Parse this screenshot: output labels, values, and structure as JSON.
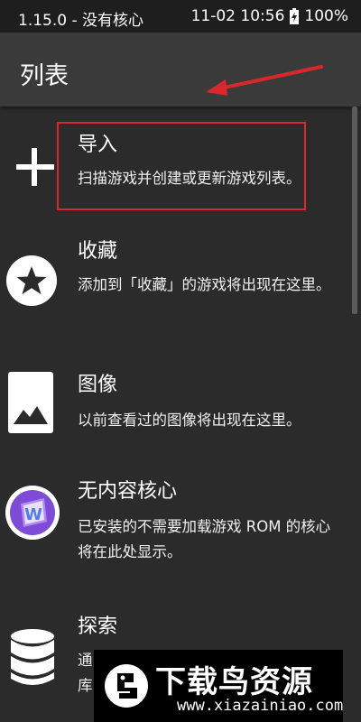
{
  "status_bar": {
    "left_text": "1.15.0 - 没有核心",
    "datetime": "11-02 10:56",
    "battery": "100%",
    "battery_icon": "battery-charging-icon"
  },
  "app_bar": {
    "title": "列表"
  },
  "items": [
    {
      "title": "导入",
      "desc": "扫描游戏并创建或更新游戏列表。",
      "icon": "plus-icon"
    },
    {
      "title": "收藏",
      "desc": "添加到「收藏」的游戏将出现在这里。",
      "icon": "star-icon"
    },
    {
      "title": "图像",
      "desc": "以前查看过的图像将出现在这里。",
      "icon": "image-icon"
    },
    {
      "title": "无内容核心",
      "desc": "已安装的不需要加载游戏 ROM 的核心将在此处显示。",
      "icon": "app-core-icon"
    },
    {
      "title": "探索",
      "desc": "通库",
      "icon": "database-icon"
    }
  ],
  "watermark": {
    "title": "下载鸟资源",
    "url": "www.xiazainiao.com"
  },
  "colors": {
    "highlight": "#d8282e",
    "background": "#2b2b2b",
    "appbar": "#3a3a3a",
    "statusbar": "#1e1e1e"
  }
}
